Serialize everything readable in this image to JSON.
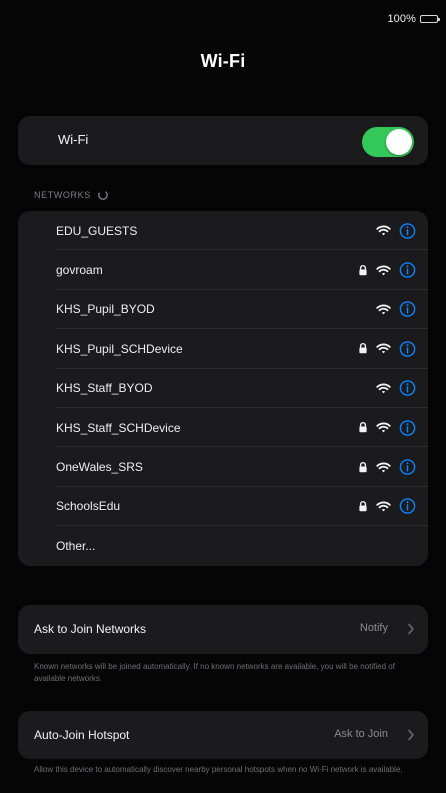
{
  "status_bar": {
    "battery_percent": "100%"
  },
  "header": {
    "title": "Wi-Fi"
  },
  "wifi_toggle": {
    "label": "Wi-Fi",
    "enabled": true
  },
  "networks": {
    "header": "NETWORKS",
    "items": [
      {
        "name": "EDU_GUESTS",
        "locked": false
      },
      {
        "name": "govroam",
        "locked": true
      },
      {
        "name": "KHS_Pupil_BYOD",
        "locked": false
      },
      {
        "name": "KHS_Pupil_SCHDevice",
        "locked": true
      },
      {
        "name": "KHS_Staff_BYOD",
        "locked": false
      },
      {
        "name": "KHS_Staff_SCHDevice",
        "locked": true
      },
      {
        "name": "OneWales_SRS",
        "locked": true
      },
      {
        "name": "SchoolsEdu",
        "locked": true
      },
      {
        "name": "Other..."
      }
    ]
  },
  "ask_to_join": {
    "label": "Ask to Join Networks",
    "value": "Notify",
    "footnote": "Known networks will be joined automatically. If no known networks are available, you will be notified of available networks."
  },
  "auto_join_hotspot": {
    "label": "Auto-Join Hotspot",
    "value": "Ask to Join",
    "footnote": "Allow this device to automatically discover nearby personal hotspots when no Wi-Fi network is available."
  },
  "colors": {
    "background": "#050505",
    "card": "#1b1b1d",
    "accent_blue": "#0a84ff",
    "toggle_green": "#34c759"
  },
  "icons": {
    "battery": "battery-icon",
    "spinner": "spinner-icon",
    "lock": "lock-icon",
    "wifi": "wifi-icon",
    "info": "info-icon",
    "chevron": "chevron-right-icon"
  }
}
